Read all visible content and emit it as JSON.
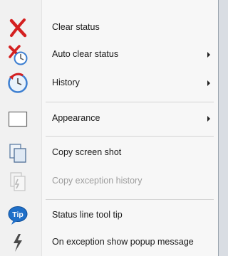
{
  "menu": {
    "items": [
      {
        "label": "Clear status",
        "icon": "red-x-icon",
        "submenu": false,
        "enabled": true
      },
      {
        "label": "Auto clear status",
        "icon": "auto-clear-clock-icon",
        "submenu": true,
        "enabled": true
      },
      {
        "label": "History",
        "icon": "history-clock-icon",
        "submenu": true,
        "enabled": true
      },
      {
        "label": "Appearance",
        "icon": "appearance-box-icon",
        "submenu": true,
        "enabled": true
      },
      {
        "label": "Copy screen shot",
        "icon": "copy-pages-icon",
        "submenu": false,
        "enabled": true
      },
      {
        "label": "Copy exception history",
        "icon": "copy-exception-icon",
        "submenu": false,
        "enabled": false
      },
      {
        "label": "Status line tool tip",
        "icon": "tip-bubble-icon",
        "submenu": false,
        "enabled": true
      },
      {
        "label": "On exception show popup message",
        "icon": "lightning-icon",
        "submenu": false,
        "enabled": true
      }
    ],
    "tip_icon_text": "Tip",
    "colors": {
      "accent_red": "#d42020",
      "clock_blue": "#3d7fd1",
      "tip_blue": "#1f6fc8",
      "disabled_text": "#9d9d9d"
    }
  }
}
